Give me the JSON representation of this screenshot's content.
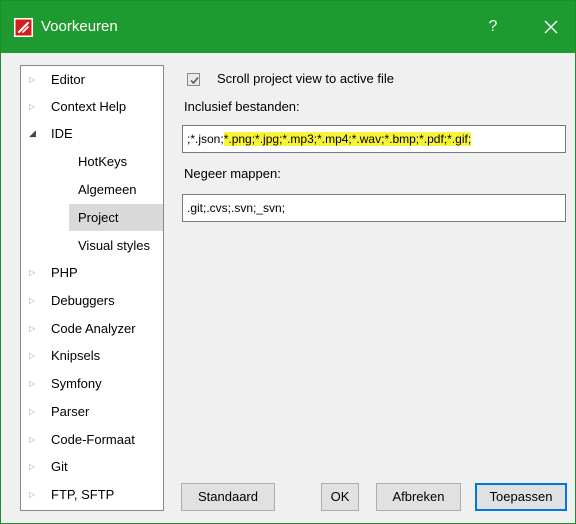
{
  "window": {
    "title": "Voorkeuren",
    "help_label": "?",
    "title_bar_color": "#1e9b30",
    "app_icon": "codelobster-logo-icon",
    "close_icon": "close-icon"
  },
  "tree": {
    "items": [
      {
        "label": "Editor",
        "expander": "collapsed"
      },
      {
        "label": "Context Help",
        "expander": "collapsed"
      },
      {
        "label": "IDE",
        "expander": "expanded"
      },
      {
        "label": "HotKeys",
        "expander": "none"
      },
      {
        "label": "Algemeen",
        "expander": "none"
      },
      {
        "label": "Project",
        "expander": "none",
        "selected": true
      },
      {
        "label": "Visual styles",
        "expander": "none"
      },
      {
        "label": "PHP",
        "expander": "collapsed"
      },
      {
        "label": "Debuggers",
        "expander": "collapsed"
      },
      {
        "label": "Code Analyzer",
        "expander": "collapsed"
      },
      {
        "label": "Knipsels",
        "expander": "collapsed"
      },
      {
        "label": "Symfony",
        "expander": "collapsed"
      },
      {
        "label": "Parser",
        "expander": "collapsed"
      },
      {
        "label": "Code-Formaat",
        "expander": "collapsed"
      },
      {
        "label": "Git",
        "expander": "collapsed"
      },
      {
        "label": "FTP, SFTP",
        "expander": "collapsed"
      }
    ]
  },
  "project": {
    "scroll_checkbox_label": "Scroll project view to active file",
    "scroll_checked": true,
    "include_label": "Inclusief bestanden:",
    "include_value_plain": ";*.json;",
    "include_value_highlighted": "*.png;*.jpg;*.mp3;*.mp4;*.wav;*.bmp;*.pdf;*.gif;",
    "highlight_color": "#f7f33a",
    "exclude_label": "Negeer mappen:",
    "exclude_value": ".git;.cvs;.svn;_svn;"
  },
  "buttons": {
    "standaard": "Standaard",
    "ok": "OK",
    "afbreken": "Afbreken",
    "toepassen": "Toepassen"
  }
}
